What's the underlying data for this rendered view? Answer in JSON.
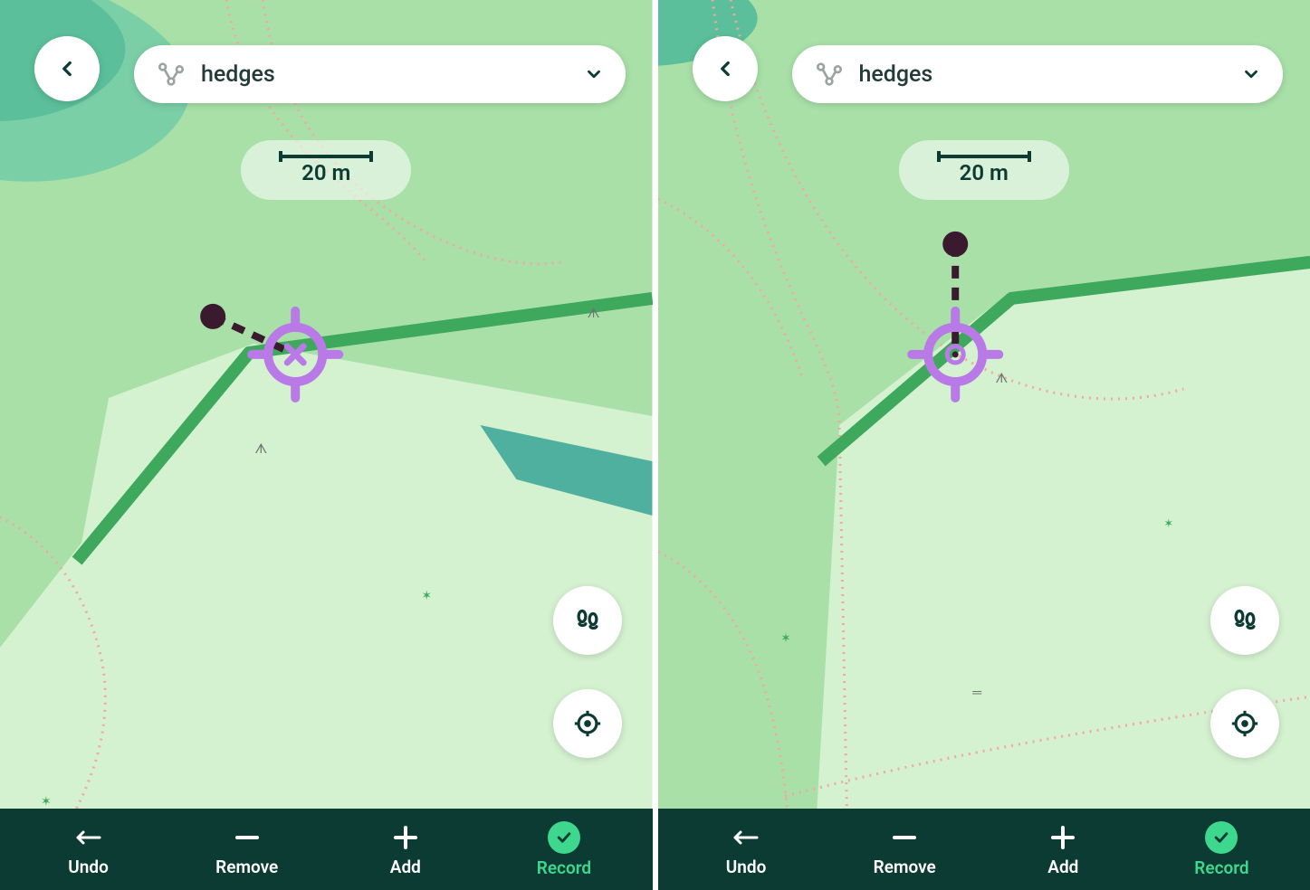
{
  "left": {
    "layer": {
      "label": "hedges"
    },
    "scale": {
      "text": "20 m"
    },
    "toolbar": {
      "undo": "Undo",
      "remove": "Remove",
      "add": "Add",
      "record": "Record"
    },
    "crosshair": {
      "mode": "x"
    }
  },
  "right": {
    "layer": {
      "label": "hedges"
    },
    "scale": {
      "text": "20 m"
    },
    "toolbar": {
      "undo": "Undo",
      "remove": "Remove",
      "add": "Add",
      "record": "Record"
    },
    "crosshair": {
      "mode": "dot"
    }
  },
  "colors": {
    "mapLight": "#bfe9bf",
    "mapMid": "#a8e0a8",
    "mapPale": "#d4f1d0",
    "mapDark": "#7bcfa7",
    "mapDarker": "#5abf9a",
    "hedge": "#3ea85d",
    "trail": "#f4a7a2",
    "teal": "#4fb0a0",
    "crosshair": "#b97ae8",
    "vertex": "#3a1a2e",
    "toolbar": "#0b3b33",
    "record": "#3dd78d"
  }
}
